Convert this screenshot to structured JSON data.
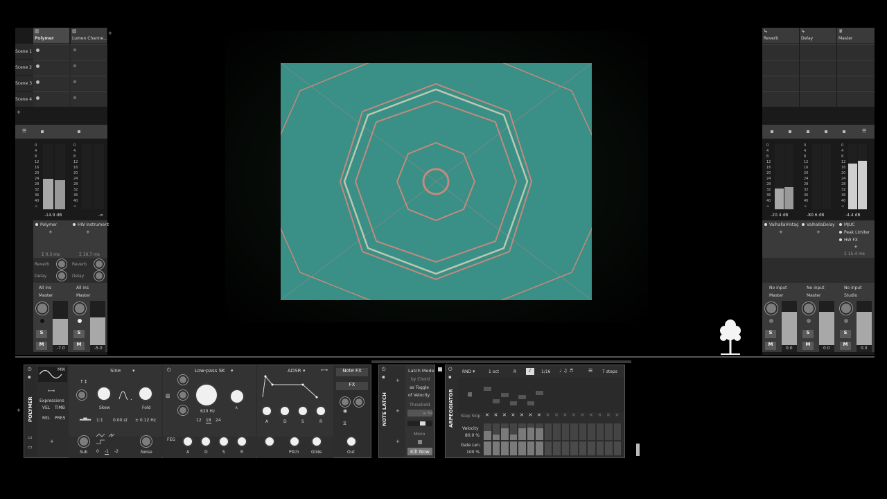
{
  "left_mixer": {
    "tracks": [
      {
        "name": "Polymer",
        "meter_scale": [
          "0",
          "4",
          "8",
          "12",
          "16",
          "20",
          "24",
          "28",
          "32",
          "36",
          "40",
          "∞"
        ],
        "db": "-14.9 dB",
        "chain": "Polymer",
        "latency": "Σ 0.3 ms",
        "send1": "Reverb",
        "send2": "Delay",
        "input": "All ins",
        "output": "Master",
        "vol": "-7.0",
        "solo": "S",
        "mute": "M"
      },
      {
        "name": "Lumen Channe...",
        "db": "-∞",
        "chain": "HW Instrument",
        "latency": "Σ 10.7 ms",
        "send1": "Reverb",
        "send2": "Delay",
        "input": "All ins",
        "output": "Master",
        "vol": "-5.0",
        "solo": "S",
        "mute": "M"
      }
    ],
    "scenes": [
      "Scene 1",
      "Scene 2",
      "Scene 3",
      "Scene 4"
    ]
  },
  "right_mixer": {
    "tracks": [
      {
        "name": "Reverb",
        "db": "-20.4 dB",
        "chain": "ValhallaVintage...",
        "input": "No input",
        "output": "Master",
        "vol": "0.0",
        "solo": "S",
        "mute": "M"
      },
      {
        "name": "Delay",
        "db": "-80.6 dB",
        "chain": "ValhallaDelay",
        "input": "No input",
        "output": "Master",
        "vol": "0.0",
        "solo": "S",
        "mute": "M"
      },
      {
        "name": "Master",
        "db": "-4.4 dB",
        "chain_list": [
          "MJUC",
          "Peak Limiter",
          "HW FX"
        ],
        "latency": "Σ 15.4 ms",
        "input": "No input",
        "output": "Studio",
        "vol": "0.0",
        "solo": "S",
        "mute": "M"
      }
    ]
  },
  "device_chain": {
    "polymer": {
      "name": "POLYMER",
      "osc_label": "MW",
      "expressions_title": "Expressions",
      "expr": [
        "VEL",
        "TIMB",
        "REL",
        "PRES"
      ],
      "wave": "Sine",
      "knobs1": [
        "Skew",
        "Fold"
      ],
      "ratio": "1:1",
      "offset": "0.00 st",
      "fine": "± 0.12 Hz",
      "sub_label": "Sub",
      "sub_opts": [
        "0",
        "-1",
        "-2"
      ],
      "noise_label": "Noise",
      "filter": "Low-pass SK",
      "cutoff": "620 Hz",
      "slopes": [
        "12",
        "18",
        "24"
      ],
      "env": "ADSR",
      "adsr": [
        "A",
        "D",
        "S",
        "R"
      ],
      "feg": "FEG",
      "pitch": "Pitch",
      "glide": "Glide",
      "note_fx": "Note FX",
      "fx": "FX",
      "out": "Out"
    },
    "note_latch": {
      "name": "NOTE LATCH",
      "latch_mode": "Latch Mode",
      "by_chord": "by Chord",
      "as_toggle": "as Toggle",
      "of_velocity": "of Velocity",
      "threshold": "Threshold",
      "threshold_val": "≥ 64",
      "mono": "Mono",
      "kill": "Kill Now"
    },
    "arpeggiator": {
      "name": "ARPEGGIATOR",
      "mode": "RND",
      "octave": "1 oct",
      "r": "R",
      "rate": "1/16",
      "steps": "7 steps",
      "step_skip": "Step Skip",
      "velocity_label": "Velocity",
      "velocity_val": "80.0 %",
      "gate_label": "Gate Len.",
      "gate_val": "100 %",
      "velocity_steps": [
        0.55,
        0.35,
        0.7,
        0.35,
        0.7,
        0.75,
        0.7,
        0.0,
        0.0,
        0.0,
        0.0,
        0.0,
        0.0,
        0.0,
        0.0,
        0.0
      ],
      "pitch_steps": [
        0.9,
        0.3,
        0.6,
        0.2,
        0.5,
        0.2,
        0.7
      ]
    }
  },
  "colors": {
    "bg": "#000000",
    "panel": "#3a3a3a",
    "visual_teal": "#3a8f86",
    "visual_line": "#e88a7a"
  }
}
